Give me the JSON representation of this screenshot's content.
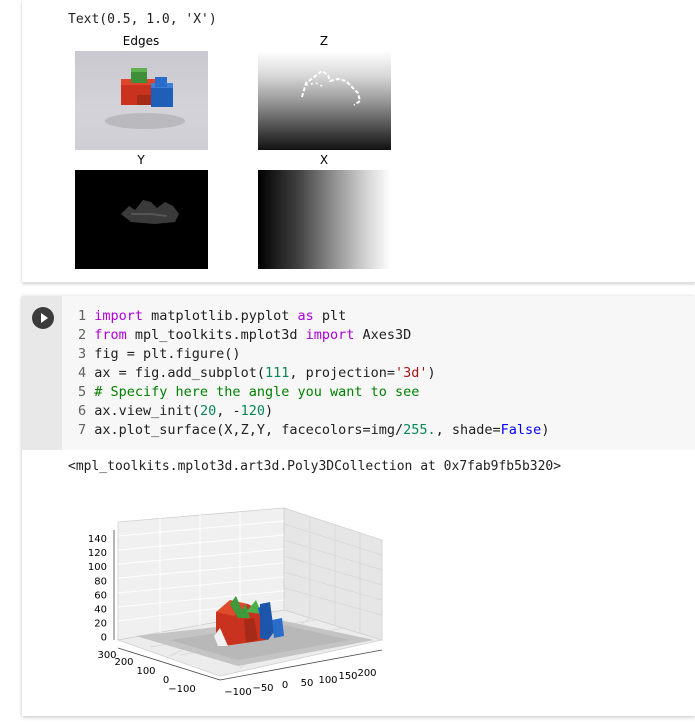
{
  "output_top": {
    "text_repr": "Text(0.5, 1.0, 'X')",
    "panels": [
      {
        "title": "Edges"
      },
      {
        "title": "Z"
      },
      {
        "title": "Y"
      },
      {
        "title": "X"
      }
    ]
  },
  "code_cell": {
    "lines": [
      {
        "n": "1",
        "parts": [
          [
            "kw",
            "import"
          ],
          [
            "p",
            " matplotlib.pyplot "
          ],
          [
            "kw",
            "as"
          ],
          [
            "p",
            " plt"
          ]
        ]
      },
      {
        "n": "2",
        "parts": [
          [
            "kw",
            "from"
          ],
          [
            "p",
            " mpl_toolkits.mplot3d "
          ],
          [
            "kw",
            "import"
          ],
          [
            "p",
            " Axes3D"
          ]
        ]
      },
      {
        "n": "3",
        "parts": [
          [
            "p",
            "fig = plt.figure()"
          ]
        ]
      },
      {
        "n": "4",
        "parts": [
          [
            "p",
            "ax = fig.add_subplot("
          ],
          [
            "num",
            "111"
          ],
          [
            "p",
            ", projection="
          ],
          [
            "str",
            "'3d'"
          ],
          [
            "p",
            ")"
          ]
        ]
      },
      {
        "n": "5",
        "parts": [
          [
            "cmt",
            "# Specify here the angle you want to see"
          ]
        ]
      },
      {
        "n": "6",
        "parts": [
          [
            "p",
            "ax.view_init("
          ],
          [
            "num",
            "20"
          ],
          [
            "p",
            ", -"
          ],
          [
            "num",
            "120"
          ],
          [
            "p",
            ")"
          ]
        ]
      },
      {
        "n": "7",
        "parts": [
          [
            "p",
            "ax.plot_surface(X,Z,Y, facecolors=img/"
          ],
          [
            "num",
            "255."
          ],
          [
            "p",
            ", shade="
          ],
          [
            "kw2",
            "False"
          ],
          [
            "p",
            ")"
          ]
        ]
      }
    ]
  },
  "output_bottom": {
    "text_repr": "<mpl_toolkits.mplot3d.art3d.Poly3DCollection at 0x7fab9fb5b320>",
    "z_ticks": [
      "140",
      "120",
      "100",
      "80",
      "60",
      "40",
      "20",
      "0"
    ],
    "x_ticks": [
      "300",
      "200",
      "100",
      "0",
      "−100"
    ],
    "y_ticks": [
      "−100",
      "−50",
      "0",
      "50",
      "100",
      "150",
      "200"
    ]
  }
}
